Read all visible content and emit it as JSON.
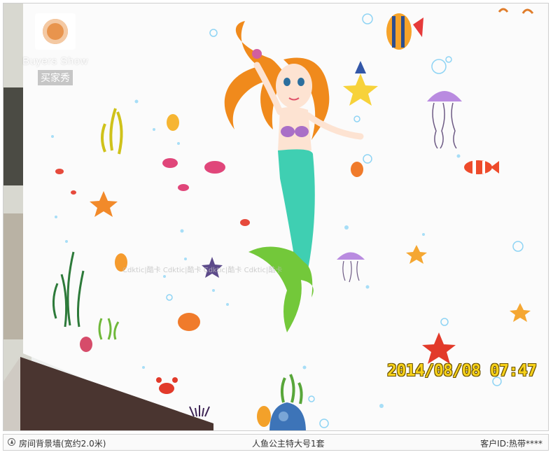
{
  "badge": {
    "brand": "Buyers Show",
    "label_cn": "买家秀",
    "icon": "camera-lens-logo"
  },
  "photo": {
    "timestamp": "2014/08/08 07:47",
    "watermark": "Cdktic|酷卡   Cdktic|酷卡   Cdktic|酷卡   Cdktic|酷卡",
    "colors": {
      "mermaid_hair": "#f08a1c",
      "mermaid_tail": "#3fcfb2",
      "jellyfish": "#b98be0",
      "starfish": "#f6a935",
      "wall": "#ffffff",
      "timestamp": "#f7d21b"
    }
  },
  "caption": {
    "icon": "location-icon",
    "left": "房间背景墙(宽约2.0米)",
    "center": "人鱼公主特大号1套",
    "right": "客户ID:热带****"
  }
}
